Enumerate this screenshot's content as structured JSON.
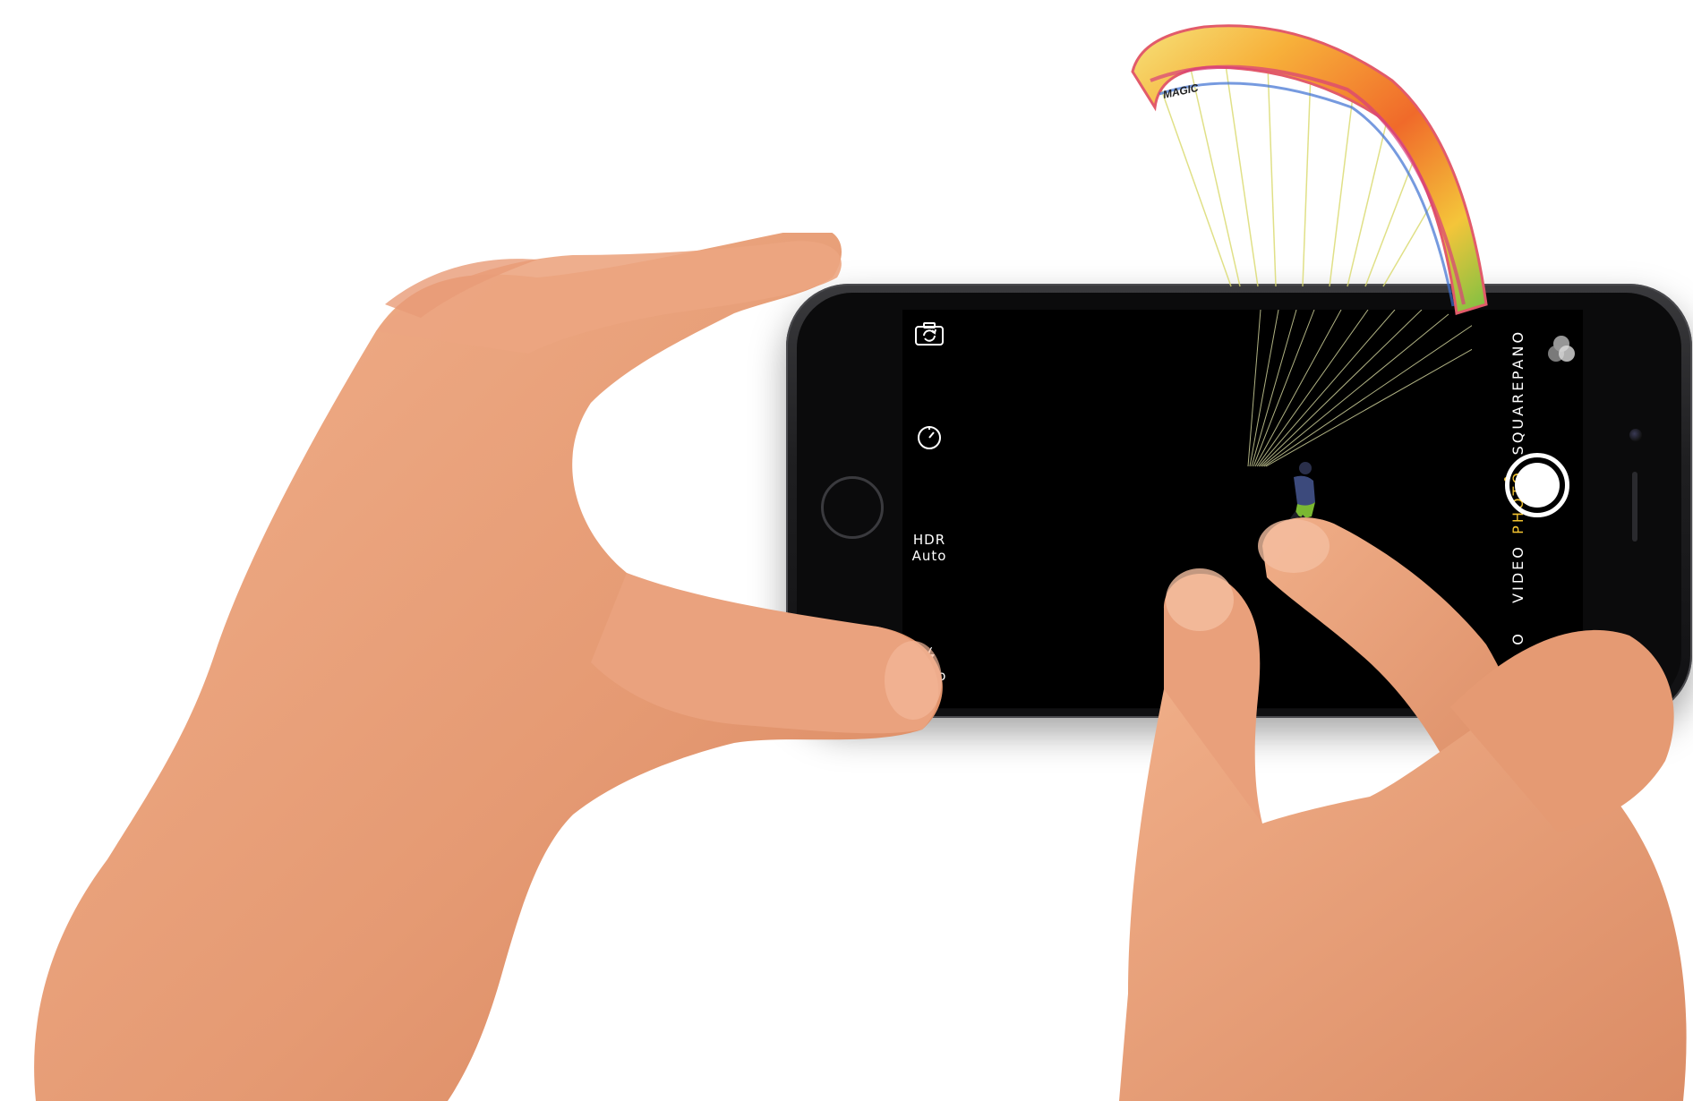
{
  "camera": {
    "left_controls": {
      "flip_camera_icon": "camera-flip-icon",
      "timer_icon": "timer-icon",
      "hdr_label": "HDR",
      "hdr_value": "Auto",
      "flash_icon": "flash-icon",
      "flash_value": "Auto"
    },
    "modes": [
      {
        "label": "PANO",
        "active": false
      },
      {
        "label": "SQUARE",
        "active": false
      },
      {
        "label": "PHOTO",
        "active": true
      },
      {
        "label": "VIDEO",
        "active": false
      },
      {
        "label": "O",
        "active": false
      }
    ],
    "filters_icon": "filters-icon",
    "shutter_icon": "shutter-button",
    "canopy_text": "MAGIC"
  },
  "colors": {
    "active_mode": "#f4c430",
    "skin": "#e8a27d",
    "phone_body": "#1f1f21"
  }
}
